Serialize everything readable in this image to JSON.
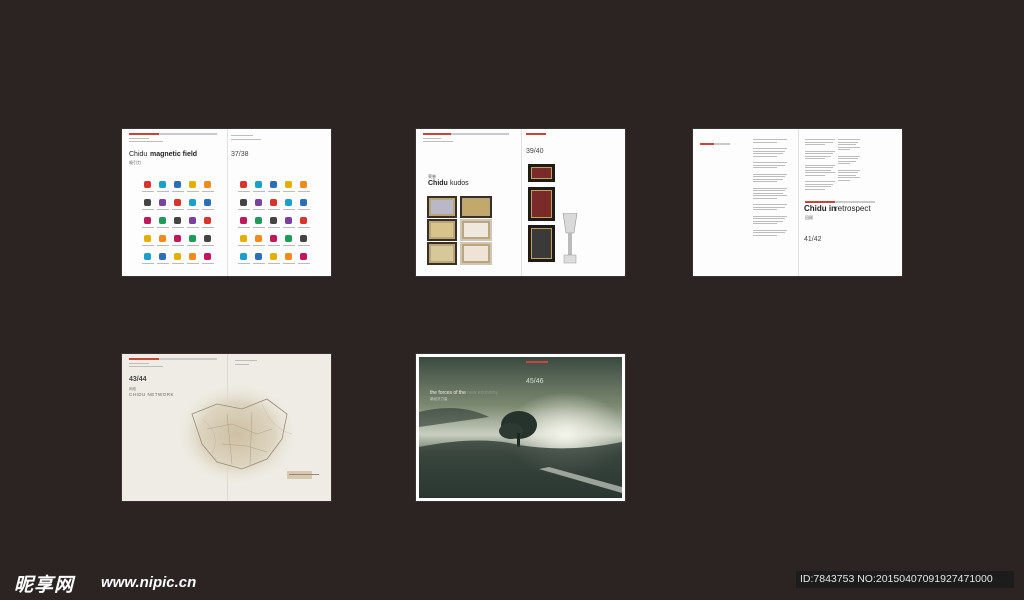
{
  "spreads": {
    "magnetic": {
      "brand": "Chidu",
      "title": "magnetic field",
      "subtitle": "吸引力",
      "pages": "37/38"
    },
    "kudos": {
      "subtitle": "荣誉",
      "brand": "Chidu",
      "title": "kudos",
      "pages": "39/40"
    },
    "retrospect": {
      "brand": "Chidu in",
      "title": "retrospect",
      "subtitle": "回顾",
      "pages": "41/42"
    },
    "network": {
      "pages": "43/44",
      "title": "CHIDU NETWORK",
      "subtitle": "网络"
    },
    "forces": {
      "title": "the forces of the",
      "title_faded": "new economy",
      "subtitle": "新经济力量",
      "pages": "45/46"
    }
  },
  "watermark": {
    "logo": "昵享网",
    "url": "www.nipic.cn",
    "id_text": "ID:7843753 NO:20150407091927471000"
  },
  "colors": {
    "background": "#2b2422",
    "accent": "#c8453a"
  }
}
